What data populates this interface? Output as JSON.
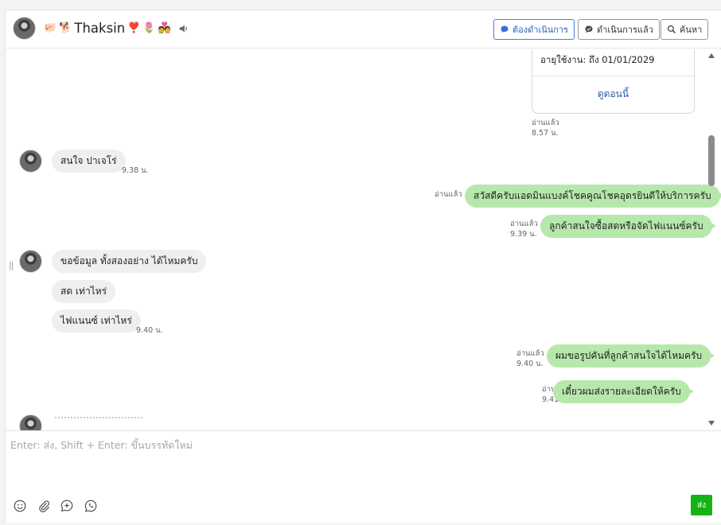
{
  "header": {
    "contact_name": "Thaksin",
    "emoji_prefix": [
      "🐖",
      "🐕"
    ],
    "emoji_suffix": [
      "❣️",
      "🌷",
      "💑"
    ],
    "buttons": {
      "todo": "ต้องดำเนินการ",
      "done": "ดำเนินการแล้ว",
      "search": "ค้นหา"
    }
  },
  "card": {
    "expiry": "อายุใช้งาน: ถึง 01/01/2029",
    "link": "ดูตอนนี้"
  },
  "messages": [
    {
      "id": "m0",
      "dir": "out",
      "read": "อ่านแล้ว",
      "time": "8.57 น."
    },
    {
      "id": "m1",
      "dir": "in",
      "text": "สนใจ ปาเจโร่",
      "time": "9.38 น."
    },
    {
      "id": "m2",
      "dir": "out",
      "text": "สวัสดีครับแอดมินแบงค์โชคคูณโชคอุดรยินดีให้บริการครับ",
      "read": "อ่านแล้ว",
      "time": ""
    },
    {
      "id": "m3",
      "dir": "out",
      "text": "ลูกค้าสนใจซื้อสดหรือจัดไฟแนนซ์ครับ",
      "read": "อ่านแล้ว",
      "time": "9.39 น."
    },
    {
      "id": "m4",
      "dir": "in",
      "text": "ขอข้อมูล ทั้งสองอย่าง ได้ไหมครับ",
      "time": ""
    },
    {
      "id": "m5",
      "dir": "in",
      "text": "สด เท่าไหร่",
      "time": ""
    },
    {
      "id": "m6",
      "dir": "in",
      "text": "ไฟแนนซ์ เท่าไหร่",
      "time": "9.40 น."
    },
    {
      "id": "m7",
      "dir": "out",
      "text": "ผมขอรูปคันที่ลูกค้าสนใจได้ไหมครับ",
      "read": "อ่านแล้ว",
      "time": "9.40 น."
    },
    {
      "id": "m8",
      "dir": "out",
      "text": "เดี๋ยวผมส่งรายละเอียดให้ครับ",
      "read": "อ่านแล้ว",
      "time": "9.41 น."
    }
  ],
  "composer": {
    "placeholder": "Enter: ส่ง, Shift + Enter: ขึ้นบรรทัดใหม่",
    "send_label": "ส่ง"
  },
  "colors": {
    "incoming_bubble": "#eeeff1",
    "outgoing_bubble": "#b7e8ab",
    "send_button": "#15b315",
    "link": "#2d5aa8",
    "todo_accent": "#2f5fbf"
  }
}
